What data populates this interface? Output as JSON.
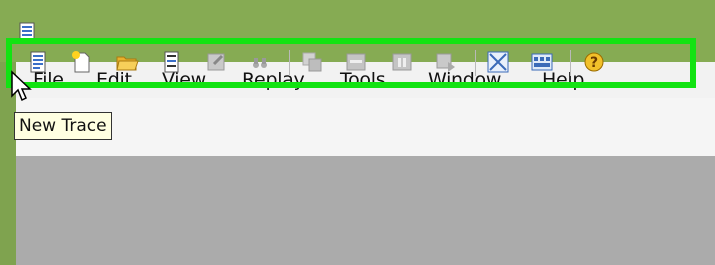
{
  "app": {
    "icon": "document-icon"
  },
  "menu": [
    {
      "id": "file",
      "label": "File"
    },
    {
      "id": "edit",
      "label": "Edit"
    },
    {
      "id": "view",
      "label": "View"
    },
    {
      "id": "replay",
      "label": "Replay"
    },
    {
      "id": "tools",
      "label": "Tools"
    },
    {
      "id": "window",
      "label": "Window"
    },
    {
      "id": "help",
      "label": "Help"
    }
  ],
  "toolbar": {
    "highlight_color": "#12e312",
    "buttons": [
      {
        "name": "new-trace",
        "icon": "document-icon",
        "enabled": true
      },
      {
        "name": "new-template",
        "icon": "new-document-icon",
        "enabled": true
      },
      {
        "name": "open",
        "icon": "folder-open-icon",
        "enabled": true
      },
      {
        "name": "properties",
        "icon": "properties-icon",
        "enabled": true
      },
      {
        "name": "save",
        "icon": "save-icon",
        "enabled": false
      },
      {
        "name": "find",
        "icon": "binoculars-icon",
        "enabled": false
      },
      {
        "name": "copy",
        "icon": "copy-icon",
        "enabled": false
      },
      {
        "name": "clear",
        "icon": "clear-icon",
        "enabled": false
      },
      {
        "name": "pause",
        "icon": "pause-icon",
        "enabled": false
      },
      {
        "name": "stop",
        "icon": "stop-icon",
        "enabled": false
      },
      {
        "name": "activity-monitor",
        "icon": "activity-monitor-icon",
        "enabled": true
      },
      {
        "name": "performance",
        "icon": "performance-icon",
        "enabled": true
      },
      {
        "name": "help",
        "icon": "help-icon",
        "enabled": true
      }
    ]
  },
  "tooltip": {
    "text": "New Trace"
  }
}
